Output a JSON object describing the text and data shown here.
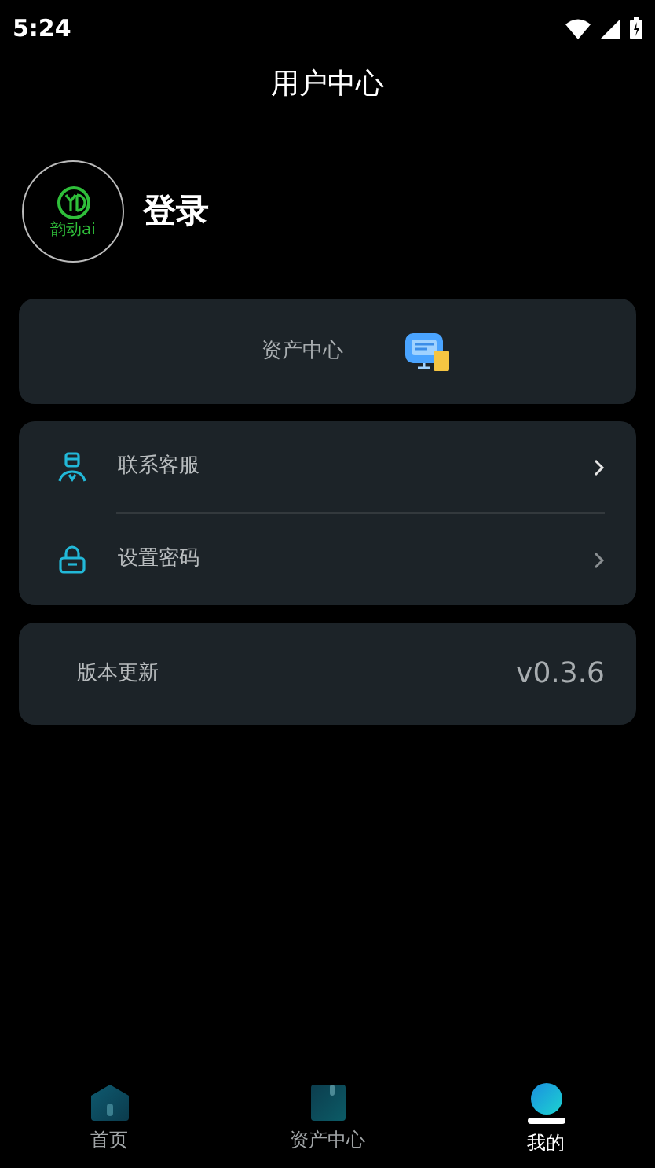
{
  "status_bar": {
    "time": "5:24"
  },
  "header": {
    "title": "用户中心"
  },
  "profile": {
    "logo_text": "韵动ai",
    "name": "登录"
  },
  "asset_card": {
    "label": "资产中心"
  },
  "menu": [
    {
      "kind": "service",
      "label": "联系客服"
    },
    {
      "kind": "lock",
      "label": "设置密码"
    }
  ],
  "version": {
    "label": "版本更新",
    "value": "v0.3.6"
  },
  "tabs": [
    {
      "kind": "home",
      "label": "首页",
      "selected": false
    },
    {
      "kind": "assets",
      "label": "资产中心",
      "selected": false
    },
    {
      "kind": "mine",
      "label": "我的",
      "selected": true
    }
  ]
}
